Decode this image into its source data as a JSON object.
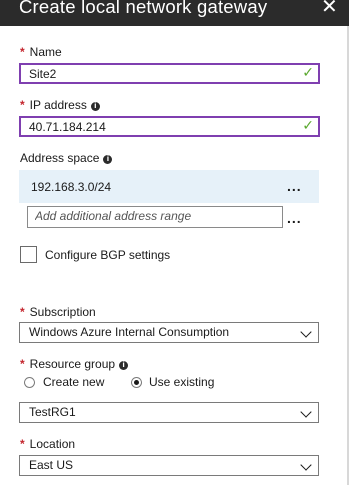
{
  "header": {
    "title": "Create local network gateway",
    "close_glyph": "✕"
  },
  "name": {
    "label": "Name",
    "value": "Site2",
    "required": "*"
  },
  "ip_address": {
    "label": "IP address",
    "value": "40.71.184.214",
    "required": "*"
  },
  "address_space": {
    "label": "Address space",
    "entries": [
      "192.168.3.0/24"
    ],
    "placeholder": "Add additional address range",
    "more": "..."
  },
  "bgp": {
    "label": "Configure BGP settings",
    "checked": false
  },
  "subscription": {
    "label": "Subscription",
    "value": "Windows Azure Internal Consumption",
    "required": "*"
  },
  "resource_group": {
    "label": "Resource group",
    "required": "*",
    "options": [
      "Create new",
      "Use existing"
    ],
    "selected": "Use existing",
    "value": "TestRG1"
  },
  "location": {
    "label": "Location",
    "value": "East US",
    "required": "*"
  },
  "icons": {
    "info": "info-icon",
    "check": "checkmark-icon",
    "chevron": "chevron-down-icon"
  },
  "colors": {
    "header_bg": "#2b2b2b",
    "valid_border": "#7f3fb0",
    "check": "#5aa82e",
    "required": "#c4262e",
    "selected_row": "#e6f1f9"
  }
}
